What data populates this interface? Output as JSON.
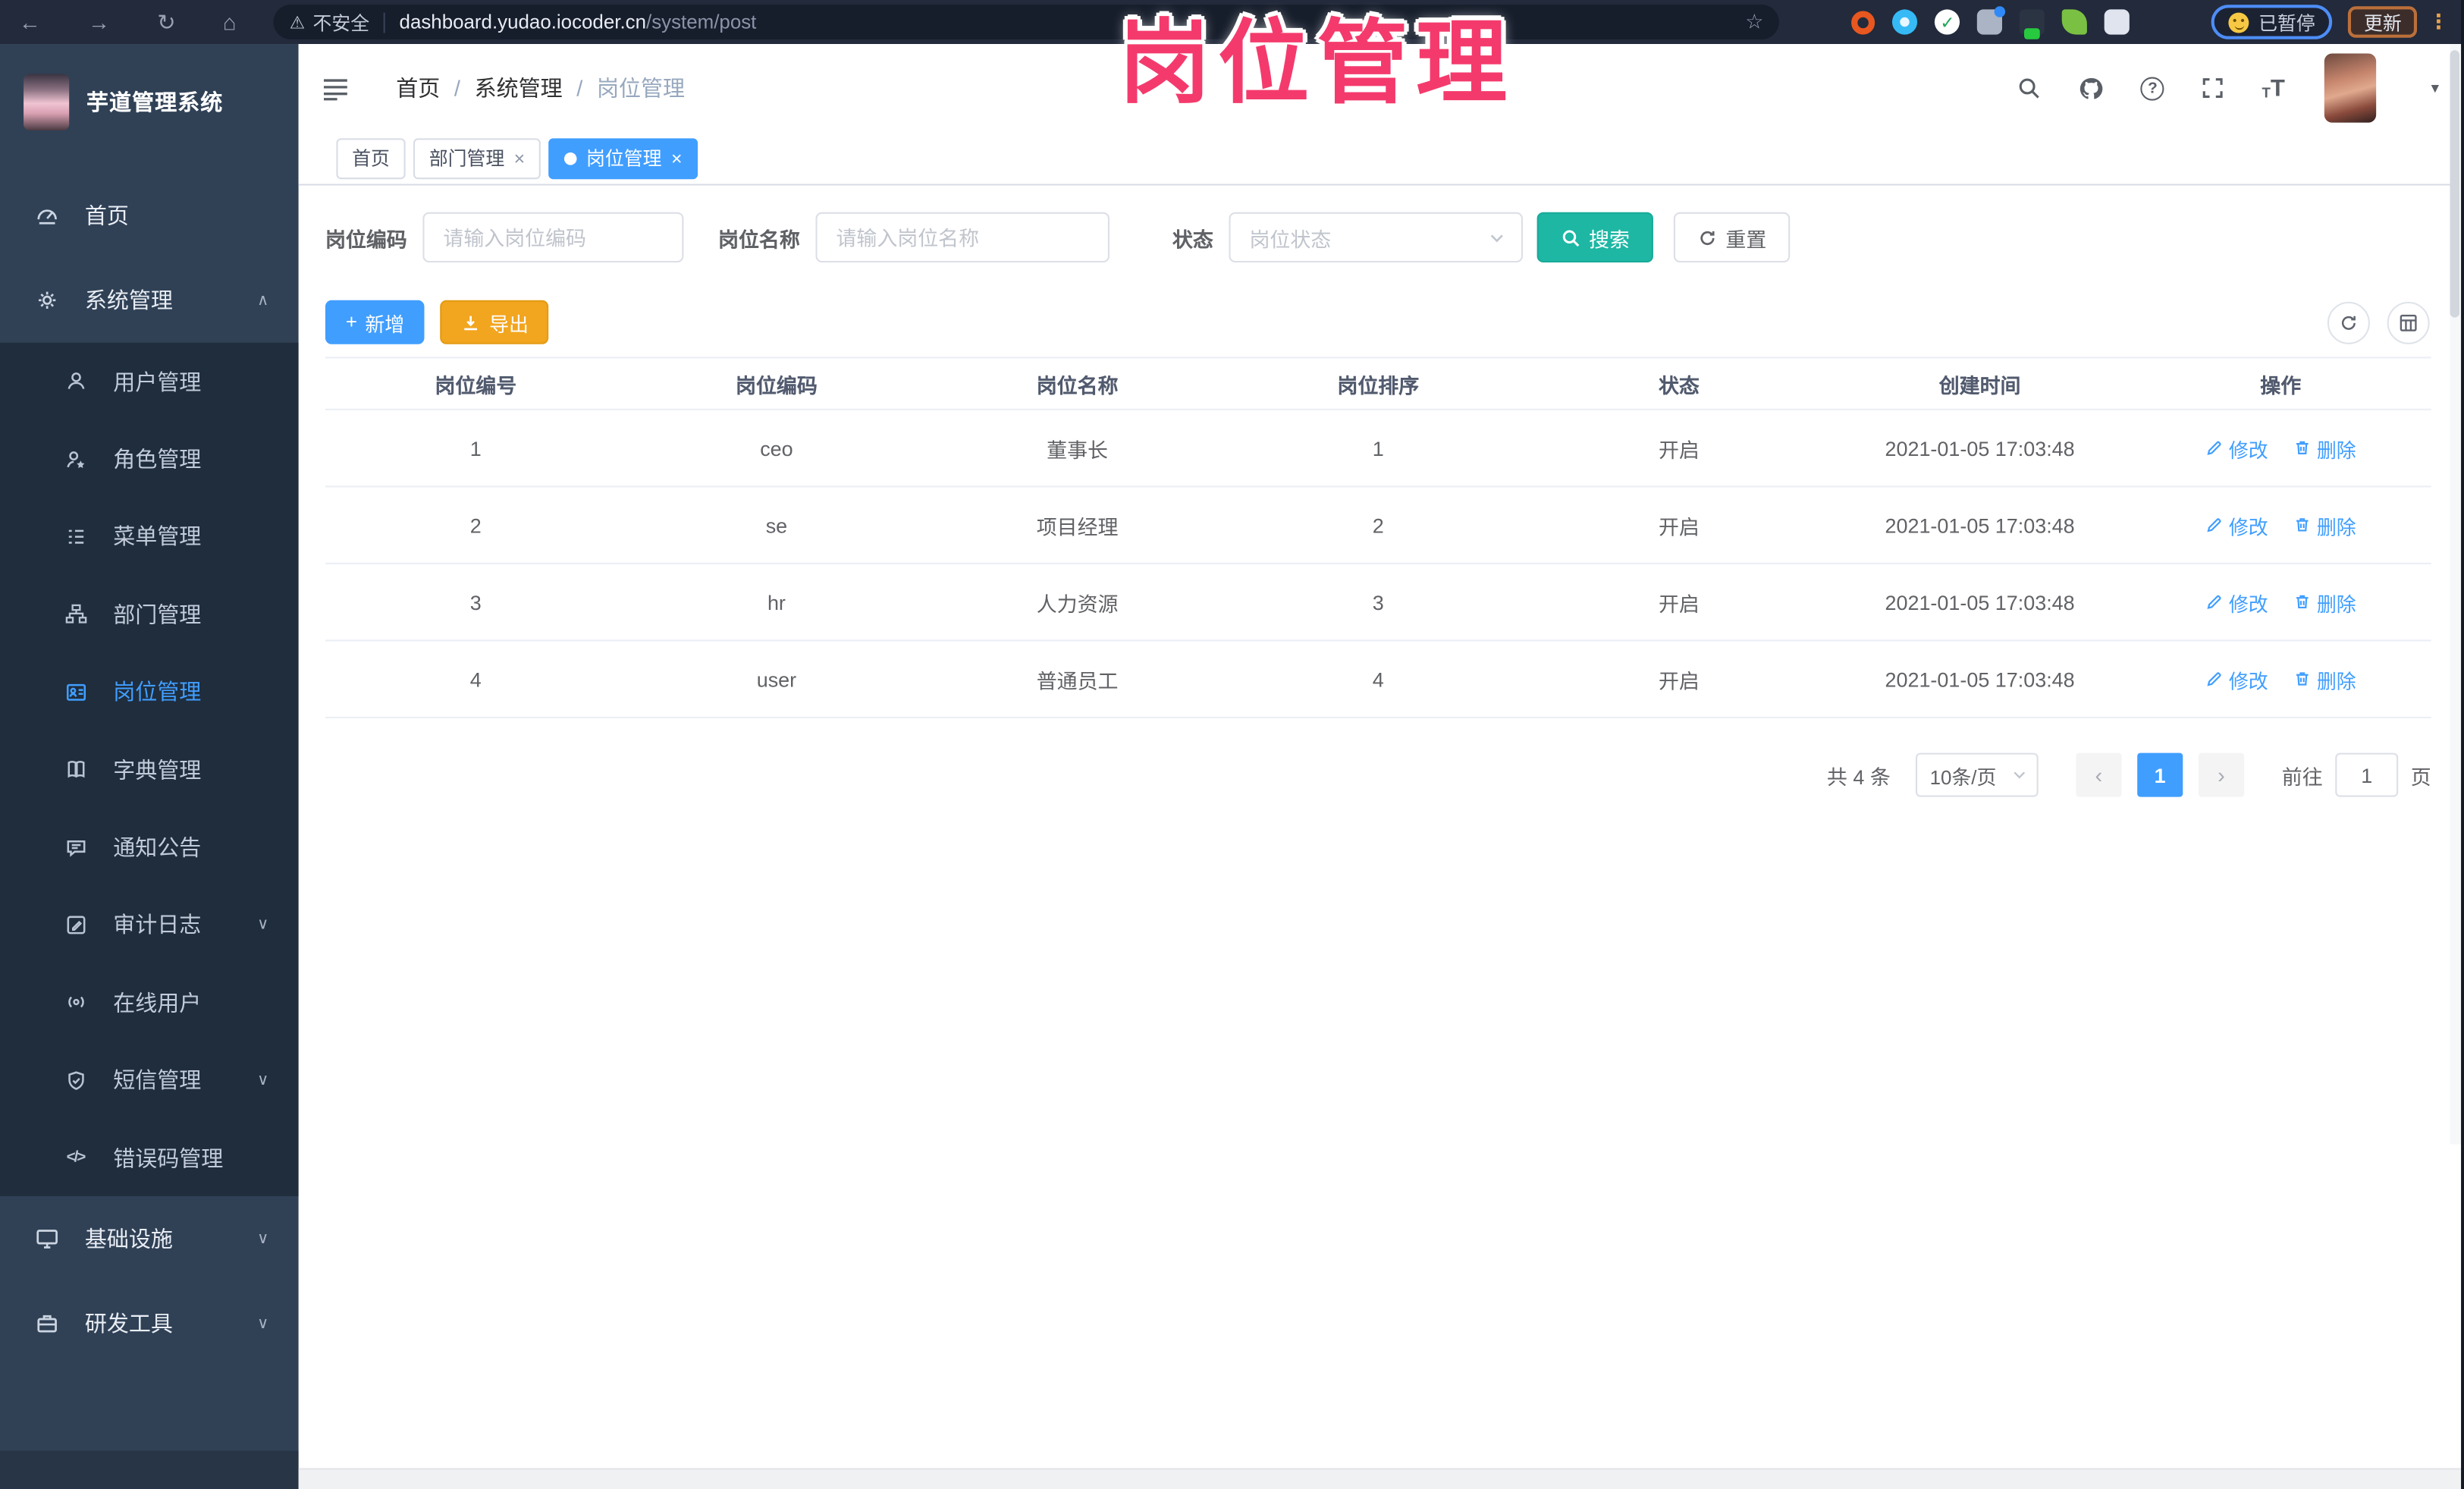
{
  "browser": {
    "security_label": "不安全",
    "url_host": "dashboard.yudao.iocoder.cn",
    "url_path": "/system/post",
    "paused_label": "已暂停",
    "update_label": "更新"
  },
  "icons": {
    "back": "←",
    "forward": "→",
    "reload": "↻",
    "home": "⌂",
    "warning": "⚠",
    "star": "☆",
    "kebab": "⋮",
    "check": "✓",
    "close": "×",
    "caret_down": "▾",
    "chevron_up": "∧",
    "chevron_down": "∨",
    "prev": "‹",
    "next": "›",
    "plus": "+",
    "question_mark": "?",
    "font_large": "T",
    "font_small": "T",
    "code": "</>"
  },
  "overlay": {
    "title": "岗位管理"
  },
  "sidebar": {
    "logo_title": "芋道管理系统",
    "items": [
      {
        "label": "首页",
        "icon": "dashboard-icon"
      },
      {
        "label": "系统管理",
        "icon": "gear-icon"
      },
      {
        "label": "用户管理",
        "icon": "user-icon"
      },
      {
        "label": "角色管理",
        "icon": "role-icon"
      },
      {
        "label": "菜单管理",
        "icon": "menu-list-icon"
      },
      {
        "label": "部门管理",
        "icon": "org-tree-icon"
      },
      {
        "label": "岗位管理",
        "icon": "post-badge-icon"
      },
      {
        "label": "字典管理",
        "icon": "dictionary-icon"
      },
      {
        "label": "通知公告",
        "icon": "announcement-icon"
      },
      {
        "label": "审计日志",
        "icon": "audit-log-icon"
      },
      {
        "label": "在线用户",
        "icon": "online-user-icon"
      },
      {
        "label": "短信管理",
        "icon": "sms-icon"
      },
      {
        "label": "错误码管理",
        "icon": "error-code-icon"
      },
      {
        "label": "基础设施",
        "icon": "infrastructure-icon"
      },
      {
        "label": "研发工具",
        "icon": "dev-tools-icon"
      }
    ]
  },
  "header": {
    "breadcrumb": [
      "首页",
      "系统管理",
      "岗位管理"
    ],
    "separator": "/"
  },
  "tabs": [
    {
      "label": "首页"
    },
    {
      "label": "部门管理"
    },
    {
      "label": "岗位管理"
    }
  ],
  "filters": {
    "code_label": "岗位编码",
    "code_placeholder": "请输入岗位编码",
    "name_label": "岗位名称",
    "name_placeholder": "请输入岗位名称",
    "status_label": "状态",
    "status_placeholder": "岗位状态",
    "search_label": "搜索",
    "reset_label": "重置"
  },
  "toolbar": {
    "add_label": "新增",
    "export_label": "导出"
  },
  "table": {
    "columns": [
      "岗位编号",
      "岗位编码",
      "岗位名称",
      "岗位排序",
      "状态",
      "创建时间",
      "操作"
    ],
    "rows": [
      {
        "id": "1",
        "code": "ceo",
        "name": "董事长",
        "sort": "1",
        "status": "开启",
        "created": "2021-01-05 17:03:48"
      },
      {
        "id": "2",
        "code": "se",
        "name": "项目经理",
        "sort": "2",
        "status": "开启",
        "created": "2021-01-05 17:03:48"
      },
      {
        "id": "3",
        "code": "hr",
        "name": "人力资源",
        "sort": "3",
        "status": "开启",
        "created": "2021-01-05 17:03:48"
      },
      {
        "id": "4",
        "code": "user",
        "name": "普通员工",
        "sort": "4",
        "status": "开启",
        "created": "2021-01-05 17:03:48"
      }
    ],
    "edit_label": "修改",
    "delete_label": "删除"
  },
  "pagination": {
    "total_label": "共 4 条",
    "page_size_label": "10条/页",
    "current_page": "1",
    "goto_label": "前往",
    "goto_page": "1",
    "page_unit_label": "页"
  }
}
